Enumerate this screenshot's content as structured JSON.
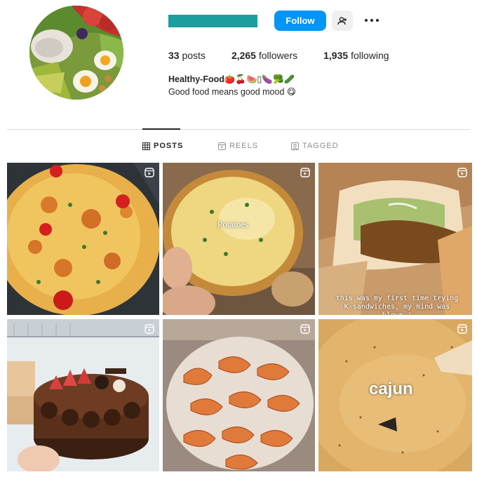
{
  "profile": {
    "avatar_icon": "profile-avatar-food-plate",
    "username_redacted_color": "#1a9e9e"
  },
  "actions": {
    "follow_label": "Follow",
    "follow_color": "#0095f6",
    "add_user_icon": "add-user-icon",
    "more_icon": "more-dots-icon"
  },
  "stats": {
    "posts_count": "33",
    "posts_label": "posts",
    "followers_count": "2,265",
    "followers_label": "followers",
    "following_count": "1,935",
    "following_label": "following"
  },
  "bio": {
    "name": "Healthy-Food🍅🍒🍉▯🍆🥦🥒",
    "text": "Good food means good mood 😋"
  },
  "tabs": [
    {
      "label": "POSTS",
      "icon": "grid-icon",
      "active": true
    },
    {
      "label": "REELS",
      "icon": "reels-icon",
      "active": false
    },
    {
      "label": "TAGGED",
      "icon": "tagged-icon",
      "active": false
    }
  ],
  "posts": [
    {
      "type": "reel",
      "caption": ""
    },
    {
      "type": "reel",
      "caption": "Potatoes"
    },
    {
      "type": "reel",
      "caption": "this was my first time trying K-sandwiches, my mind was blown !"
    },
    {
      "type": "reel",
      "caption": ""
    },
    {
      "type": "reel",
      "caption": ""
    },
    {
      "type": "reel",
      "caption": "cajun"
    }
  ]
}
